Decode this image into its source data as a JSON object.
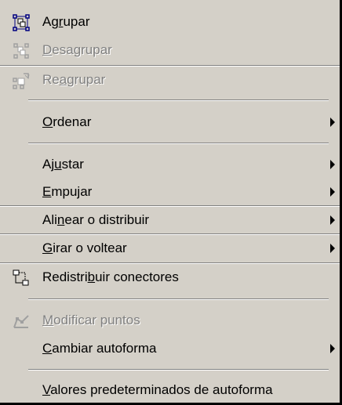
{
  "menu": {
    "items": {
      "agrupar": {
        "pre": "Ag",
        "key": "r",
        "post": "upar",
        "icon": "group-icon",
        "enabled": true
      },
      "desagrupar": {
        "pre": "",
        "key": "D",
        "post": "esagrupar",
        "icon": "ungroup-icon",
        "enabled": false
      },
      "reagrupar": {
        "pre": "Re",
        "key": "a",
        "post": "grupar",
        "icon": "regroup-icon",
        "enabled": false
      },
      "ordenar": {
        "pre": "",
        "key": "O",
        "post": "rdenar",
        "submenu": true
      },
      "ajustar": {
        "pre": "Aj",
        "key": "u",
        "post": "star",
        "submenu": true
      },
      "empujar": {
        "pre": "",
        "key": "E",
        "post": "mpujar",
        "submenu": true
      },
      "alinear": {
        "pre": "Ali",
        "key": "n",
        "post": "ear o distribuir",
        "submenu": true
      },
      "girar": {
        "pre": "",
        "key": "G",
        "post": "irar o voltear",
        "submenu": true
      },
      "redistribuir": {
        "pre": "Redistri",
        "key": "b",
        "post": "uir conectores",
        "icon": "reroute-connectors-icon",
        "enabled": true
      },
      "modificar": {
        "pre": "",
        "key": "M",
        "post": "odificar puntos",
        "icon": "edit-points-icon",
        "enabled": false
      },
      "cambiar": {
        "pre": "",
        "key": "C",
        "post": "ambiar autoforma",
        "submenu": true
      },
      "valores": {
        "pre": "",
        "key": "V",
        "post": "alores predeterminados de autoforma",
        "submenu": false
      }
    }
  },
  "colors": {
    "menu_bg": "#d4d0c8",
    "text": "#000000",
    "disabled_text": "#808080",
    "icon_blue": "#000080"
  }
}
